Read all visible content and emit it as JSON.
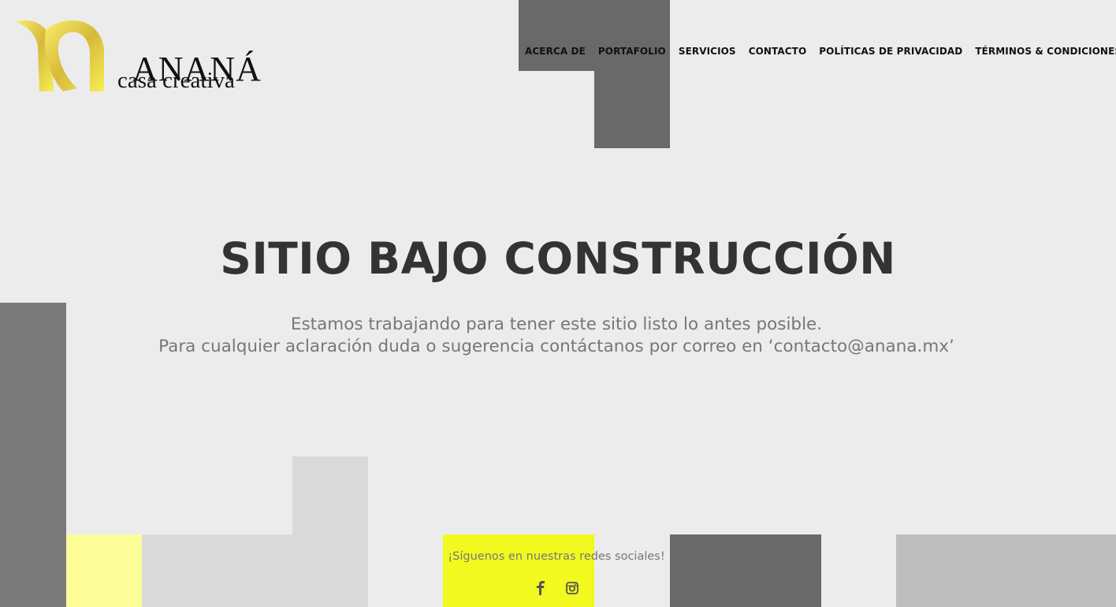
{
  "brand": {
    "name": "ANANÁ",
    "tagline": "casa creativa",
    "logo_icon": "n-ribbon-logo",
    "gold_light": "#f5ef56",
    "gold_dark": "#c9a52a"
  },
  "nav": {
    "items": [
      {
        "label": "ACERCA DE"
      },
      {
        "label": "PORTAFOLIO"
      },
      {
        "label": "SERVICIOS"
      },
      {
        "label": "CONTACTO"
      },
      {
        "label": "POLÍTICAS DE PRIVACIDAD"
      },
      {
        "label": "TÉRMINOS & CONDICIONES"
      }
    ]
  },
  "main": {
    "headline": "SITIO BAJO CONSTRUCCIÓN",
    "line1": "Estamos trabajando para tener este sitio listo lo antes posible.",
    "line2": "Para cualquier aclaración duda o sugerencia contáctanos por correo en ‘contacto@anana.mx’"
  },
  "footer": {
    "follow_text": "¡Síguenos en nuestras redes sociales!",
    "social": [
      {
        "icon": "facebook-icon"
      },
      {
        "icon": "instagram-icon"
      }
    ]
  },
  "colors": {
    "background": "#ececec",
    "dark_gray": "#696969",
    "yellow": "#f1f91f",
    "light_yellow": "#fdfd9a",
    "headline": "#333333",
    "body_text": "#777777"
  }
}
